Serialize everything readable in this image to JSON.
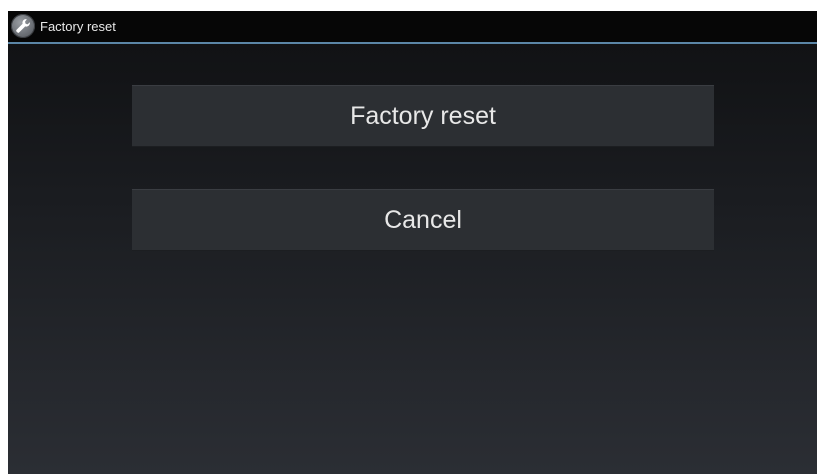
{
  "titlebar": {
    "icon": "wrench-icon",
    "title": "Factory reset"
  },
  "dialog": {
    "confirm_label": "Factory reset",
    "cancel_label": "Cancel"
  },
  "colors": {
    "titlebar_background": "#060606",
    "titlebar_divider": "#5b86a7",
    "button_background": "#2c2f33",
    "text": "#e8e8e8"
  }
}
